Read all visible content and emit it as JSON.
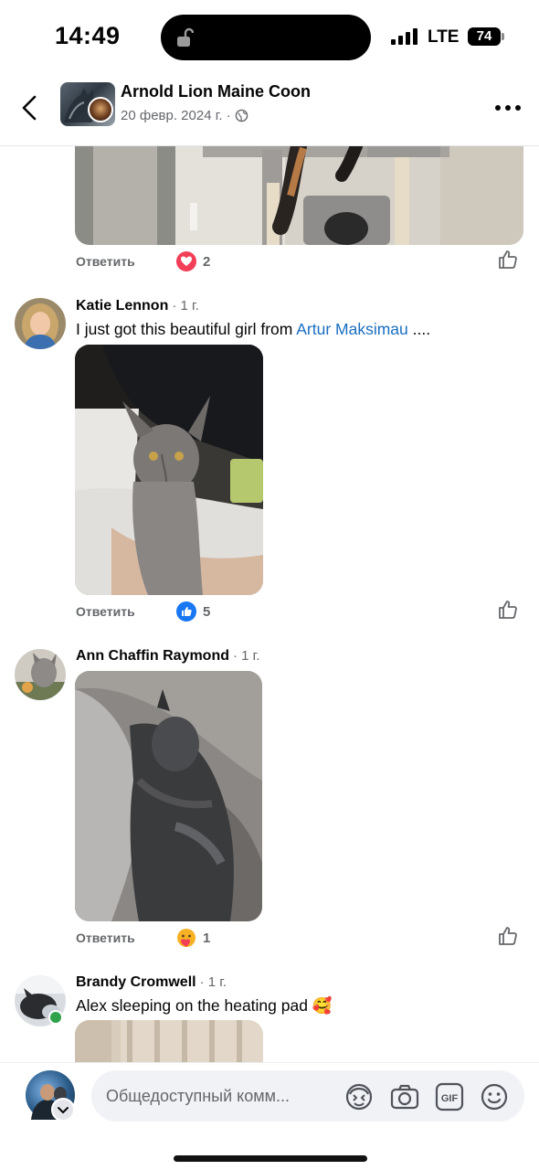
{
  "status_bar": {
    "time": "14:49",
    "network": "LTE",
    "battery": "74"
  },
  "header": {
    "title": "Arnold Lion Maine Coon",
    "date": "20 февр. 2024 г. ·",
    "icons": {
      "back": "chevron-left-icon",
      "privacy": "globe-icon",
      "more": "more-horizontal-icon"
    }
  },
  "top_comment": {
    "reply_label": "Ответить",
    "reaction_icon": "heart-icon",
    "reaction_count": "2"
  },
  "comments": [
    {
      "author": "Katie Lennon",
      "time": "· 1 г.",
      "text": "I just got this beautiful girl from",
      "mention": "Artur Maksimau",
      "text_suffix": " ....",
      "reply_label": "Ответить",
      "reaction_icon": "like-reaction-icon",
      "reaction_count": "5"
    },
    {
      "author": "Ann Chaffin Raymond",
      "time": "· 1 г.",
      "reply_label": "Ответить",
      "reaction_icon": "care-reaction-icon",
      "reaction_count": "1"
    },
    {
      "author": "Brandy Cromwell",
      "time": "· 1 г.",
      "text": "Alex sleeping on the heating pad 🥰",
      "online": true
    }
  ],
  "composer": {
    "placeholder": "Общедоступный комм...",
    "icons": [
      "avatar-sticker-icon",
      "camera-icon",
      "gif-icon",
      "emoji-icon"
    ]
  },
  "colors": {
    "link": "#1a6ec1",
    "secondary_text": "#65676b",
    "like_blue": "#1877f2",
    "heart_red": "#f33e58",
    "online_green": "#31a24c"
  }
}
